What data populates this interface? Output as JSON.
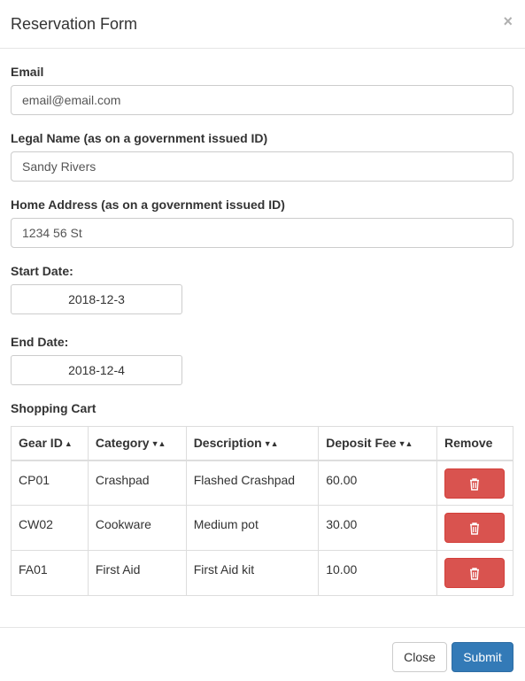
{
  "modal": {
    "title": "Reservation Form",
    "close_symbol": "×"
  },
  "form": {
    "email": {
      "label": "Email",
      "value": "email@email.com"
    },
    "legal_name": {
      "label": "Legal Name (as on a government issued ID)",
      "value": "Sandy Rivers"
    },
    "home_address": {
      "label": "Home Address (as on a government issued ID)",
      "value": "1234 56 St"
    },
    "start_date": {
      "label": "Start Date:",
      "value": "2018-12-3"
    },
    "end_date": {
      "label": "End Date:",
      "value": "2018-12-4"
    }
  },
  "cart": {
    "title": "Shopping Cart",
    "headers": {
      "gear_id": "Gear ID",
      "category": "Category",
      "description": "Description",
      "deposit_fee": "Deposit Fee",
      "remove": "Remove"
    },
    "sort_indicators": {
      "gear_id": "▲",
      "category": "▼▲",
      "description": "▼▲",
      "deposit_fee": "▼▲"
    },
    "rows": [
      {
        "gear_id": "CP01",
        "category": "Crashpad",
        "description": "Flashed Crashpad",
        "deposit_fee": "60.00"
      },
      {
        "gear_id": "CW02",
        "category": "Cookware",
        "description": "Medium pot",
        "deposit_fee": "30.00"
      },
      {
        "gear_id": "FA01",
        "category": "First Aid",
        "description": "First Aid kit",
        "deposit_fee": "10.00"
      }
    ],
    "remove_icon": "trash-icon"
  },
  "footer": {
    "close_label": "Close",
    "submit_label": "Submit"
  },
  "colors": {
    "danger": "#d9534f",
    "primary": "#337ab7",
    "border": "#cccccc"
  }
}
